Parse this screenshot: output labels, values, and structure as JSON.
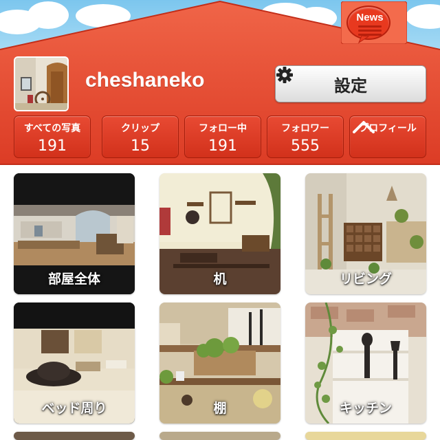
{
  "header": {
    "news_label": "News",
    "username": "cheshaneko",
    "settings_label": "設定",
    "brand_color": "#de3f28"
  },
  "stats": [
    {
      "label": "すべての写真",
      "value": "191"
    },
    {
      "label": "クリップ",
      "value": "15"
    },
    {
      "label": "フォロー中",
      "value": "191"
    },
    {
      "label": "フォロワー",
      "value": "555"
    },
    {
      "label": "プロフィール",
      "icon": "chevron-up-icon"
    }
  ],
  "albums": [
    {
      "caption": "部屋全体"
    },
    {
      "caption": "机"
    },
    {
      "caption": "リビング"
    },
    {
      "caption": "ベッド周り"
    },
    {
      "caption": "棚"
    },
    {
      "caption": "キッチン"
    }
  ]
}
